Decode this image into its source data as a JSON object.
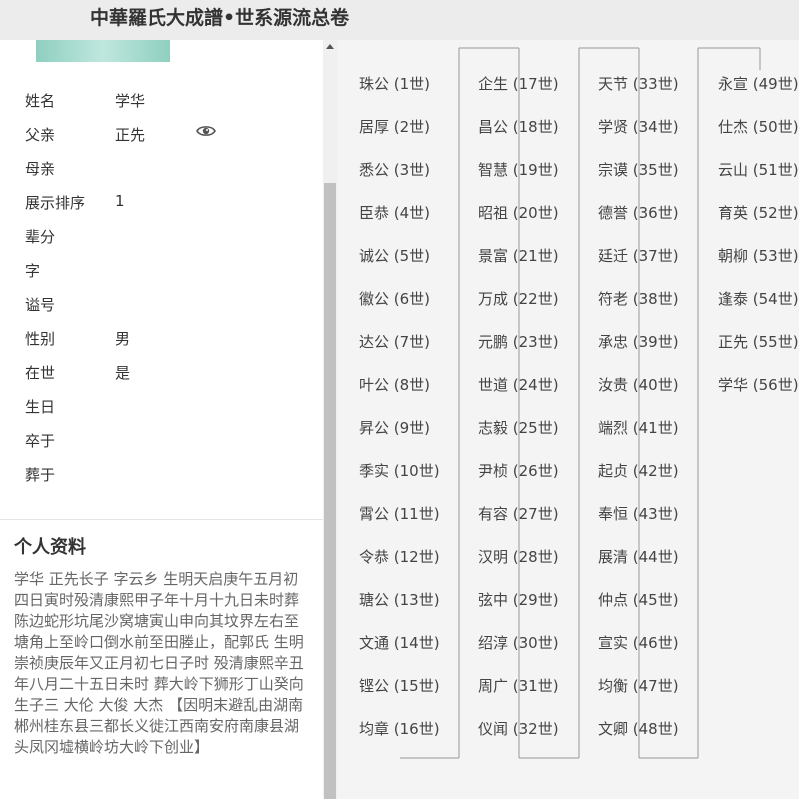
{
  "header": {
    "title": "中華羅氏大成譜•世系源流总卷"
  },
  "profile": {
    "fields": [
      {
        "label": "姓名",
        "value": "学华"
      },
      {
        "label": "父亲",
        "value": "正先"
      },
      {
        "label": "母亲",
        "value": ""
      },
      {
        "label": "展示排序",
        "value": "1"
      },
      {
        "label": "辈分",
        "value": ""
      },
      {
        "label": "字",
        "value": ""
      },
      {
        "label": "谥号",
        "value": ""
      },
      {
        "label": "性别",
        "value": "男"
      },
      {
        "label": "在世",
        "value": "是"
      },
      {
        "label": "生日",
        "value": ""
      },
      {
        "label": "卒于",
        "value": ""
      },
      {
        "label": "葬于",
        "value": ""
      }
    ],
    "eye_icon": "eye-icon"
  },
  "bio": {
    "title": "个人资料",
    "text": "学华 正先长子 字云乡 生明天启庚午五月初四日寅时殁清康熙甲子年十月十九日未时葬陈边蛇形坑尾沙窝塘寅山申向其坟界左右至塘角上至岭口倒水前至田塍止，配郭氏 生明崇祯庚辰年又正月初七日子时 殁清康熙辛丑年八月二十五日未时 葬大岭下狮形丁山癸向 生子三 大伦 大俊 大杰 【因明末避乱由湖南郴州桂东县三都长义徙江西南安府南康县湖头凤冈墟横岭坊大岭下创业】"
  },
  "generations": [
    [
      "珠公 (1世)",
      "居厚 (2世)",
      "悉公 (3世)",
      "臣恭 (4世)",
      "诚公 (5世)",
      "徽公 (6世)",
      "达公 (7世)",
      "叶公 (8世)",
      "昇公 (9世)",
      "季实 (10世)",
      "霄公 (11世)",
      "令恭 (12世)",
      "瑭公 (13世)",
      "文通 (14世)",
      "铿公 (15世)",
      "均章 (16世)"
    ],
    [
      "企生 (17世)",
      "昌公 (18世)",
      "智慧 (19世)",
      "昭祖 (20世)",
      "景富 (21世)",
      "万成 (22世)",
      "元鹏 (23世)",
      "世道 (24世)",
      "志毅 (25世)",
      "尹桢 (26世)",
      "有容 (27世)",
      "汉明 (28世)",
      "弦中 (29世)",
      "绍淳 (30世)",
      "周广 (31世)",
      "仪闻 (32世)"
    ],
    [
      "天节 (33世)",
      "学贤 (34世)",
      "宗谟 (35世)",
      "德誉 (36世)",
      "廷迁 (37世)",
      "符老 (38世)",
      "承忠 (39世)",
      "汝贵 (40世)",
      "端烈 (41世)",
      "起贞 (42世)",
      "奉恒 (43世)",
      "展清 (44世)",
      "仲点 (45世)",
      "宣实 (46世)",
      "均衡 (47世)",
      "文卿 (48世)"
    ],
    [
      "永宣 (49世)",
      "仕杰 (50世)",
      "云山 (51世)",
      "育英 (52世)",
      "朝柳 (53世)",
      "逢泰 (54世)",
      "正先 (55世)",
      "学华 (56世)"
    ]
  ]
}
